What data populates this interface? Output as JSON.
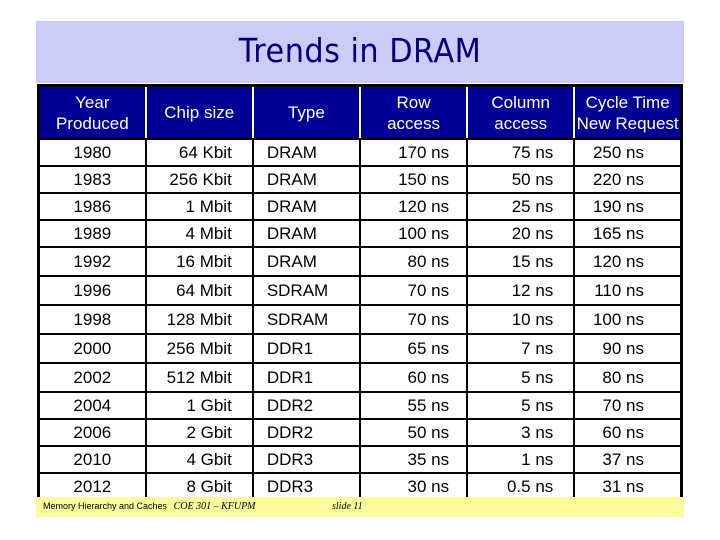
{
  "slide": {
    "title": "Trends in DRAM",
    "colors": {
      "title_band": "#ccccf8",
      "title_text": "#000080",
      "header_bg": "#000096",
      "footer_band": "#fcfc9c"
    }
  },
  "table": {
    "headers": [
      "Year Produced",
      "Chip size",
      "Type",
      "Row access",
      "Column access",
      "Cycle Time New Request"
    ],
    "rows": [
      [
        "1980",
        "64 Kbit",
        "DRAM",
        "170 ns",
        "75 ns",
        "250 ns"
      ],
      [
        "1983",
        "256 Kbit",
        "DRAM",
        "150 ns",
        "50 ns",
        "220 ns"
      ],
      [
        "1986",
        "1 Mbit",
        "DRAM",
        "120 ns",
        "25 ns",
        "190 ns"
      ],
      [
        "1989",
        "4 Mbit",
        "DRAM",
        "100 ns",
        "20 ns",
        "165 ns"
      ],
      [
        "1992",
        "16 Mbit",
        "DRAM",
        "80 ns",
        "15 ns",
        "120 ns"
      ],
      [
        "1996",
        "64 Mbit",
        "SDRAM",
        "70 ns",
        "12 ns",
        "110 ns"
      ],
      [
        "1998",
        "128 Mbit",
        "SDRAM",
        "70 ns",
        "10 ns",
        "100 ns"
      ],
      [
        "2000",
        "256 Mbit",
        "DDR1",
        "65 ns",
        "7 ns",
        "90 ns"
      ],
      [
        "2002",
        "512 Mbit",
        "DDR1",
        "60 ns",
        "5 ns",
        "80 ns"
      ],
      [
        "2004",
        "1 Gbit",
        "DDR2",
        "55 ns",
        "5 ns",
        "70 ns"
      ],
      [
        "2006",
        "2 Gbit",
        "DDR2",
        "50 ns",
        "3 ns",
        "60 ns"
      ],
      [
        "2010",
        "4 Gbit",
        "DDR3",
        "35 ns",
        "1 ns",
        "37 ns"
      ],
      [
        "2012",
        "8 Gbit",
        "DDR3",
        "30 ns",
        "0.5 ns",
        "31 ns"
      ]
    ]
  },
  "footer": {
    "topic": "Memory Hierarchy and Caches",
    "course": "COE 301 – KFUPM",
    "slide_label": "slide 11"
  }
}
